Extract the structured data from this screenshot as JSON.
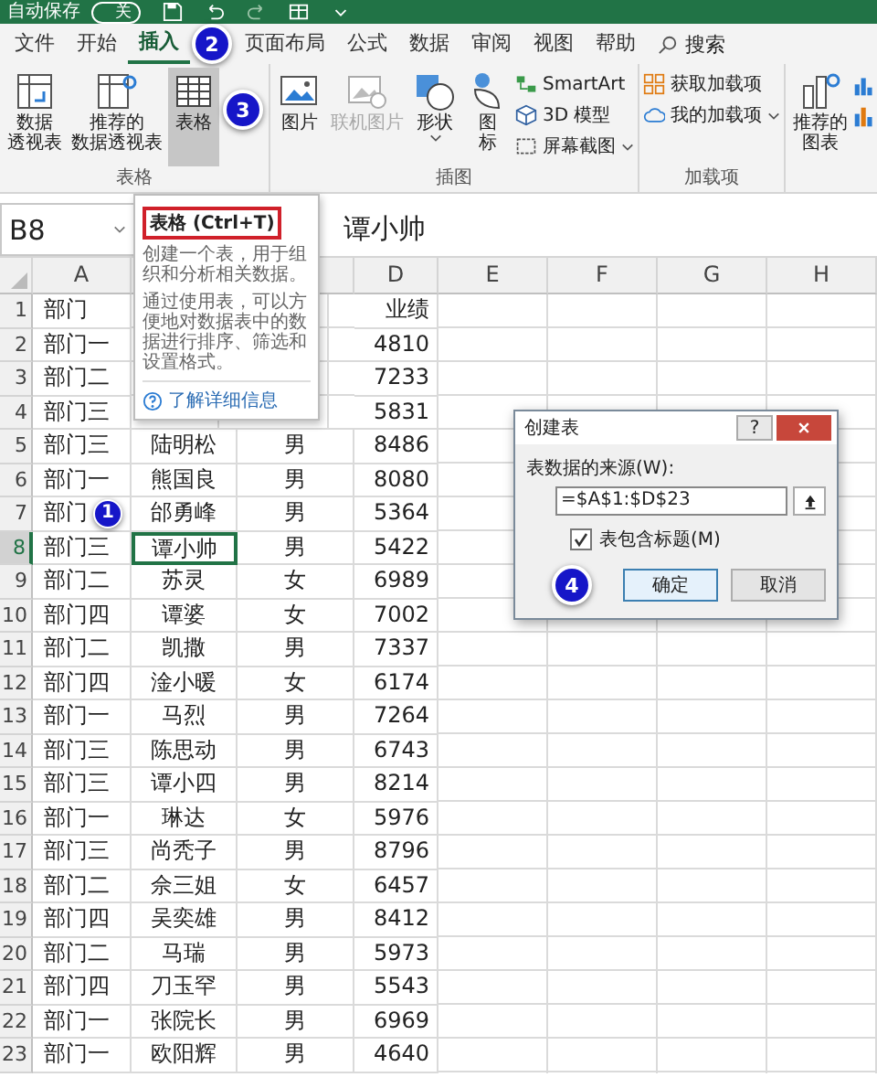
{
  "quick_access": {
    "autosave_label": "自动保存",
    "toggle": {
      "on": false,
      "label": "关"
    }
  },
  "tabs": [
    {
      "label": "文件",
      "selected": false
    },
    {
      "label": "开始",
      "selected": false
    },
    {
      "label": "插入",
      "selected": true,
      "marker": "2"
    },
    {
      "label": "页面布局",
      "selected": false
    },
    {
      "label": "公式",
      "selected": false
    },
    {
      "label": "数据",
      "selected": false
    },
    {
      "label": "审阅",
      "selected": false
    },
    {
      "label": "视图",
      "selected": false
    },
    {
      "label": "帮助",
      "selected": false
    }
  ],
  "search": {
    "label": "搜索"
  },
  "ribbon": {
    "groups": [
      {
        "label": "表格",
        "items": [
          {
            "kind": "large",
            "lines": [
              "数据",
              "透视表"
            ],
            "selected": false,
            "disabled": false,
            "dropdown": false
          },
          {
            "kind": "large",
            "lines": [
              "推荐的",
              "数据透视表"
            ],
            "selected": false,
            "disabled": false,
            "dropdown": false
          },
          {
            "kind": "large",
            "lines": [
              "表格"
            ],
            "selected": true,
            "disabled": false,
            "dropdown": false,
            "marker": "3"
          }
        ]
      },
      {
        "label": "插图",
        "items": [
          {
            "kind": "large",
            "lines": [
              "图片"
            ],
            "selected": false,
            "disabled": false,
            "dropdown": false
          },
          {
            "kind": "large",
            "lines": [
              "联机图片"
            ],
            "selected": false,
            "disabled": true,
            "dropdown": false
          },
          {
            "kind": "large",
            "lines": [
              "形状"
            ],
            "selected": false,
            "disabled": false,
            "dropdown": true
          },
          {
            "kind": "large",
            "lines": [
              "图",
              "标"
            ],
            "selected": false,
            "disabled": false,
            "dropdown": false
          },
          {
            "kind": "column",
            "items": [
              {
                "label": "SmartArt",
                "dropdown": false
              },
              {
                "label": "3D 模型",
                "dropdown": false
              },
              {
                "label": "屏幕截图",
                "dropdown": true
              }
            ]
          }
        ]
      },
      {
        "label": "加载项",
        "items": [
          {
            "kind": "column",
            "items": [
              {
                "label": "获取加载项",
                "dropdown": false
              },
              {
                "label": "我的加载项",
                "dropdown": true
              }
            ]
          }
        ]
      },
      {
        "items": [
          {
            "kind": "large",
            "lines": [
              "推荐的",
              "图表"
            ],
            "selected": false,
            "disabled": false,
            "dropdown": false
          },
          {
            "kind": "icon_grid"
          }
        ]
      }
    ]
  },
  "formula_bar": {
    "name_box": "B8",
    "value": "谭小帅"
  },
  "columns": [
    {
      "letter": "A"
    },
    {},
    {},
    {
      "letter": "D"
    },
    {
      "letter": "E"
    },
    {
      "letter": "F"
    },
    {
      "letter": "G"
    },
    {
      "letter": "H"
    }
  ],
  "rows": [
    {
      "number": "1",
      "cells": [
        "部门",
        null,
        null,
        "业绩"
      ],
      "selected": false
    },
    {
      "number": "2",
      "cells": [
        "部门一",
        null,
        null,
        "4810"
      ],
      "selected": false
    },
    {
      "number": "3",
      "cells": [
        "部门二",
        null,
        null,
        "7233"
      ],
      "selected": false
    },
    {
      "number": "4",
      "cells": [
        "部门三",
        null,
        null,
        "5831"
      ],
      "selected": false
    },
    {
      "number": "5",
      "cells": [
        "部门三",
        "陆明松",
        "男",
        "8486"
      ],
      "selected": false
    },
    {
      "number": "6",
      "cells": [
        "部门一",
        "熊国良",
        "男",
        "8080"
      ],
      "selected": false
    },
    {
      "number": "7",
      "cells": [
        "部门",
        "邰勇峰",
        "男",
        "5364"
      ],
      "selected": false,
      "marker": "1"
    },
    {
      "number": "8",
      "cells": [
        "部门三",
        "谭小帅",
        "男",
        "5422"
      ],
      "selected": true
    },
    {
      "number": "9",
      "cells": [
        "部门二",
        "苏灵",
        "女",
        "6989"
      ],
      "selected": false
    },
    {
      "number": "10",
      "cells": [
        "部门四",
        "谭婆",
        "女",
        "7002"
      ],
      "selected": false
    },
    {
      "number": "11",
      "cells": [
        "部门二",
        "凯撒",
        "男",
        "7337"
      ],
      "selected": false
    },
    {
      "number": "12",
      "cells": [
        "部门四",
        "淦小暖",
        "女",
        "6174"
      ],
      "selected": false
    },
    {
      "number": "13",
      "cells": [
        "部门一",
        "马烈",
        "男",
        "7264"
      ],
      "selected": false
    },
    {
      "number": "14",
      "cells": [
        "部门三",
        "陈思动",
        "男",
        "6743"
      ],
      "selected": false
    },
    {
      "number": "15",
      "cells": [
        "部门三",
        "谭小四",
        "男",
        "8214"
      ],
      "selected": false
    },
    {
      "number": "16",
      "cells": [
        "部门一",
        "琳达",
        "女",
        "5976"
      ],
      "selected": false
    },
    {
      "number": "17",
      "cells": [
        "部门三",
        "尚秃子",
        "男",
        "8796"
      ],
      "selected": false
    },
    {
      "number": "18",
      "cells": [
        "部门二",
        "佘三姐",
        "女",
        "6457"
      ],
      "selected": false
    },
    {
      "number": "19",
      "cells": [
        "部门四",
        "吴奕雄",
        "男",
        "8412"
      ],
      "selected": false
    },
    {
      "number": "20",
      "cells": [
        "部门二",
        "马瑞",
        "男",
        "5973"
      ],
      "selected": false
    },
    {
      "number": "21",
      "cells": [
        "部门四",
        "刀玉罕",
        "男",
        "5543"
      ],
      "selected": false
    },
    {
      "number": "22",
      "cells": [
        "部门一",
        "张院长",
        "男",
        "6969"
      ],
      "selected": false
    },
    {
      "number": "23",
      "cells": [
        "部门一",
        "欧阳辉",
        "男",
        "4640"
      ],
      "selected": false
    }
  ],
  "tooltip": {
    "title": "表格 (Ctrl+T)",
    "paragraphs": [
      "创建一个表，用于组织和分析相关数据。",
      "通过使用表，可以方便地对数据表中的数据进行排序、筛选和设置格式。"
    ],
    "link": "了解详细信息"
  },
  "dialog": {
    "title": "创建表",
    "help_button": "?",
    "source_label": "表数据的来源(W):",
    "source_value": "=$A$1:$D$23",
    "has_headers": {
      "label": "表包含标题(M)",
      "checked": true
    },
    "marker": "4",
    "buttons": [
      {
        "label": "确定",
        "focused": true
      },
      {
        "label": "取消",
        "focused": false
      }
    ]
  }
}
